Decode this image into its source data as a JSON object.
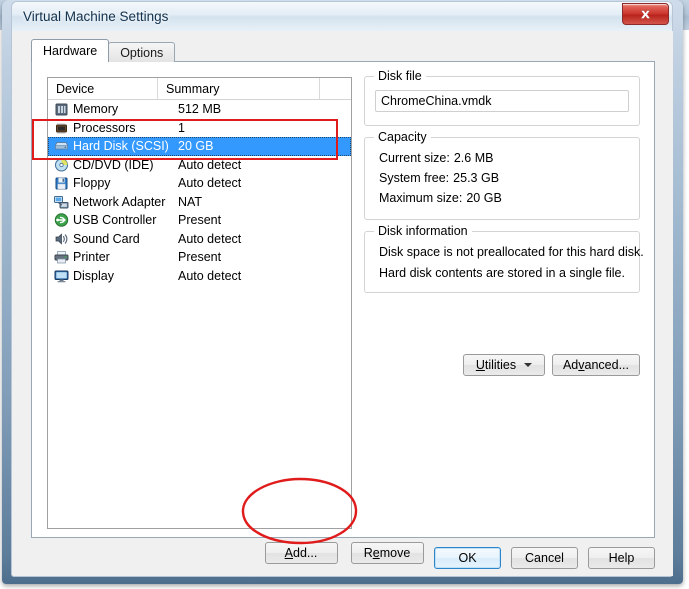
{
  "window": {
    "title": "Virtual Machine Settings",
    "ghost_background_text": "•  •  •  •  •",
    "close_label": "Close"
  },
  "tabs": [
    {
      "label": "Hardware",
      "active": true
    },
    {
      "label": "Options",
      "active": false
    }
  ],
  "device_list": {
    "columns": [
      "Device",
      "Summary",
      ""
    ],
    "rows": [
      {
        "icon": "memory-icon",
        "device": "Memory",
        "summary": "512 MB",
        "selected": false
      },
      {
        "icon": "processors-icon",
        "device": "Processors",
        "summary": "1",
        "selected": false
      },
      {
        "icon": "hard-disk-icon",
        "device": "Hard Disk (SCSI)",
        "summary": "20 GB",
        "selected": true
      },
      {
        "icon": "cd-dvd-icon",
        "device": "CD/DVD (IDE)",
        "summary": "Auto detect",
        "selected": false
      },
      {
        "icon": "floppy-icon",
        "device": "Floppy",
        "summary": "Auto detect",
        "selected": false
      },
      {
        "icon": "network-adapter-icon",
        "device": "Network Adapter",
        "summary": "NAT",
        "selected": false
      },
      {
        "icon": "usb-controller-icon",
        "device": "USB Controller",
        "summary": "Present",
        "selected": false
      },
      {
        "icon": "sound-card-icon",
        "device": "Sound Card",
        "summary": "Auto detect",
        "selected": false
      },
      {
        "icon": "printer-icon",
        "device": "Printer",
        "summary": "Present",
        "selected": false
      },
      {
        "icon": "display-icon",
        "device": "Display",
        "summary": "Auto detect",
        "selected": false
      }
    ]
  },
  "disk_file": {
    "legend": "Disk file",
    "value": "ChromeChina.vmdk"
  },
  "capacity": {
    "legend": "Capacity",
    "lines": [
      {
        "label": "Current size:",
        "value": "2.6 MB"
      },
      {
        "label": "System free:",
        "value": "25.3 GB"
      },
      {
        "label": "Maximum size:",
        "value": "20 GB"
      }
    ]
  },
  "disk_information": {
    "legend": "Disk information",
    "lines": [
      "Disk space is not preallocated for this hard disk.",
      "Hard disk contents are stored in a single file."
    ]
  },
  "buttons": {
    "utilities": {
      "pre": "U",
      "post": "tilities"
    },
    "advanced": {
      "pre": "Ad",
      "mid": "v",
      "post": "anced..."
    },
    "add": {
      "pre": "A",
      "mid": "d",
      "post": "d..."
    },
    "remove": {
      "pre": "R",
      "mid": "e",
      "post": "move"
    },
    "ok": "OK",
    "cancel": "Cancel",
    "help": "Help"
  },
  "annotations": {
    "rect_target": "hard-disk-row-highlight",
    "ellipse_target": "remove-button-highlight",
    "color": "#e01b1b"
  }
}
